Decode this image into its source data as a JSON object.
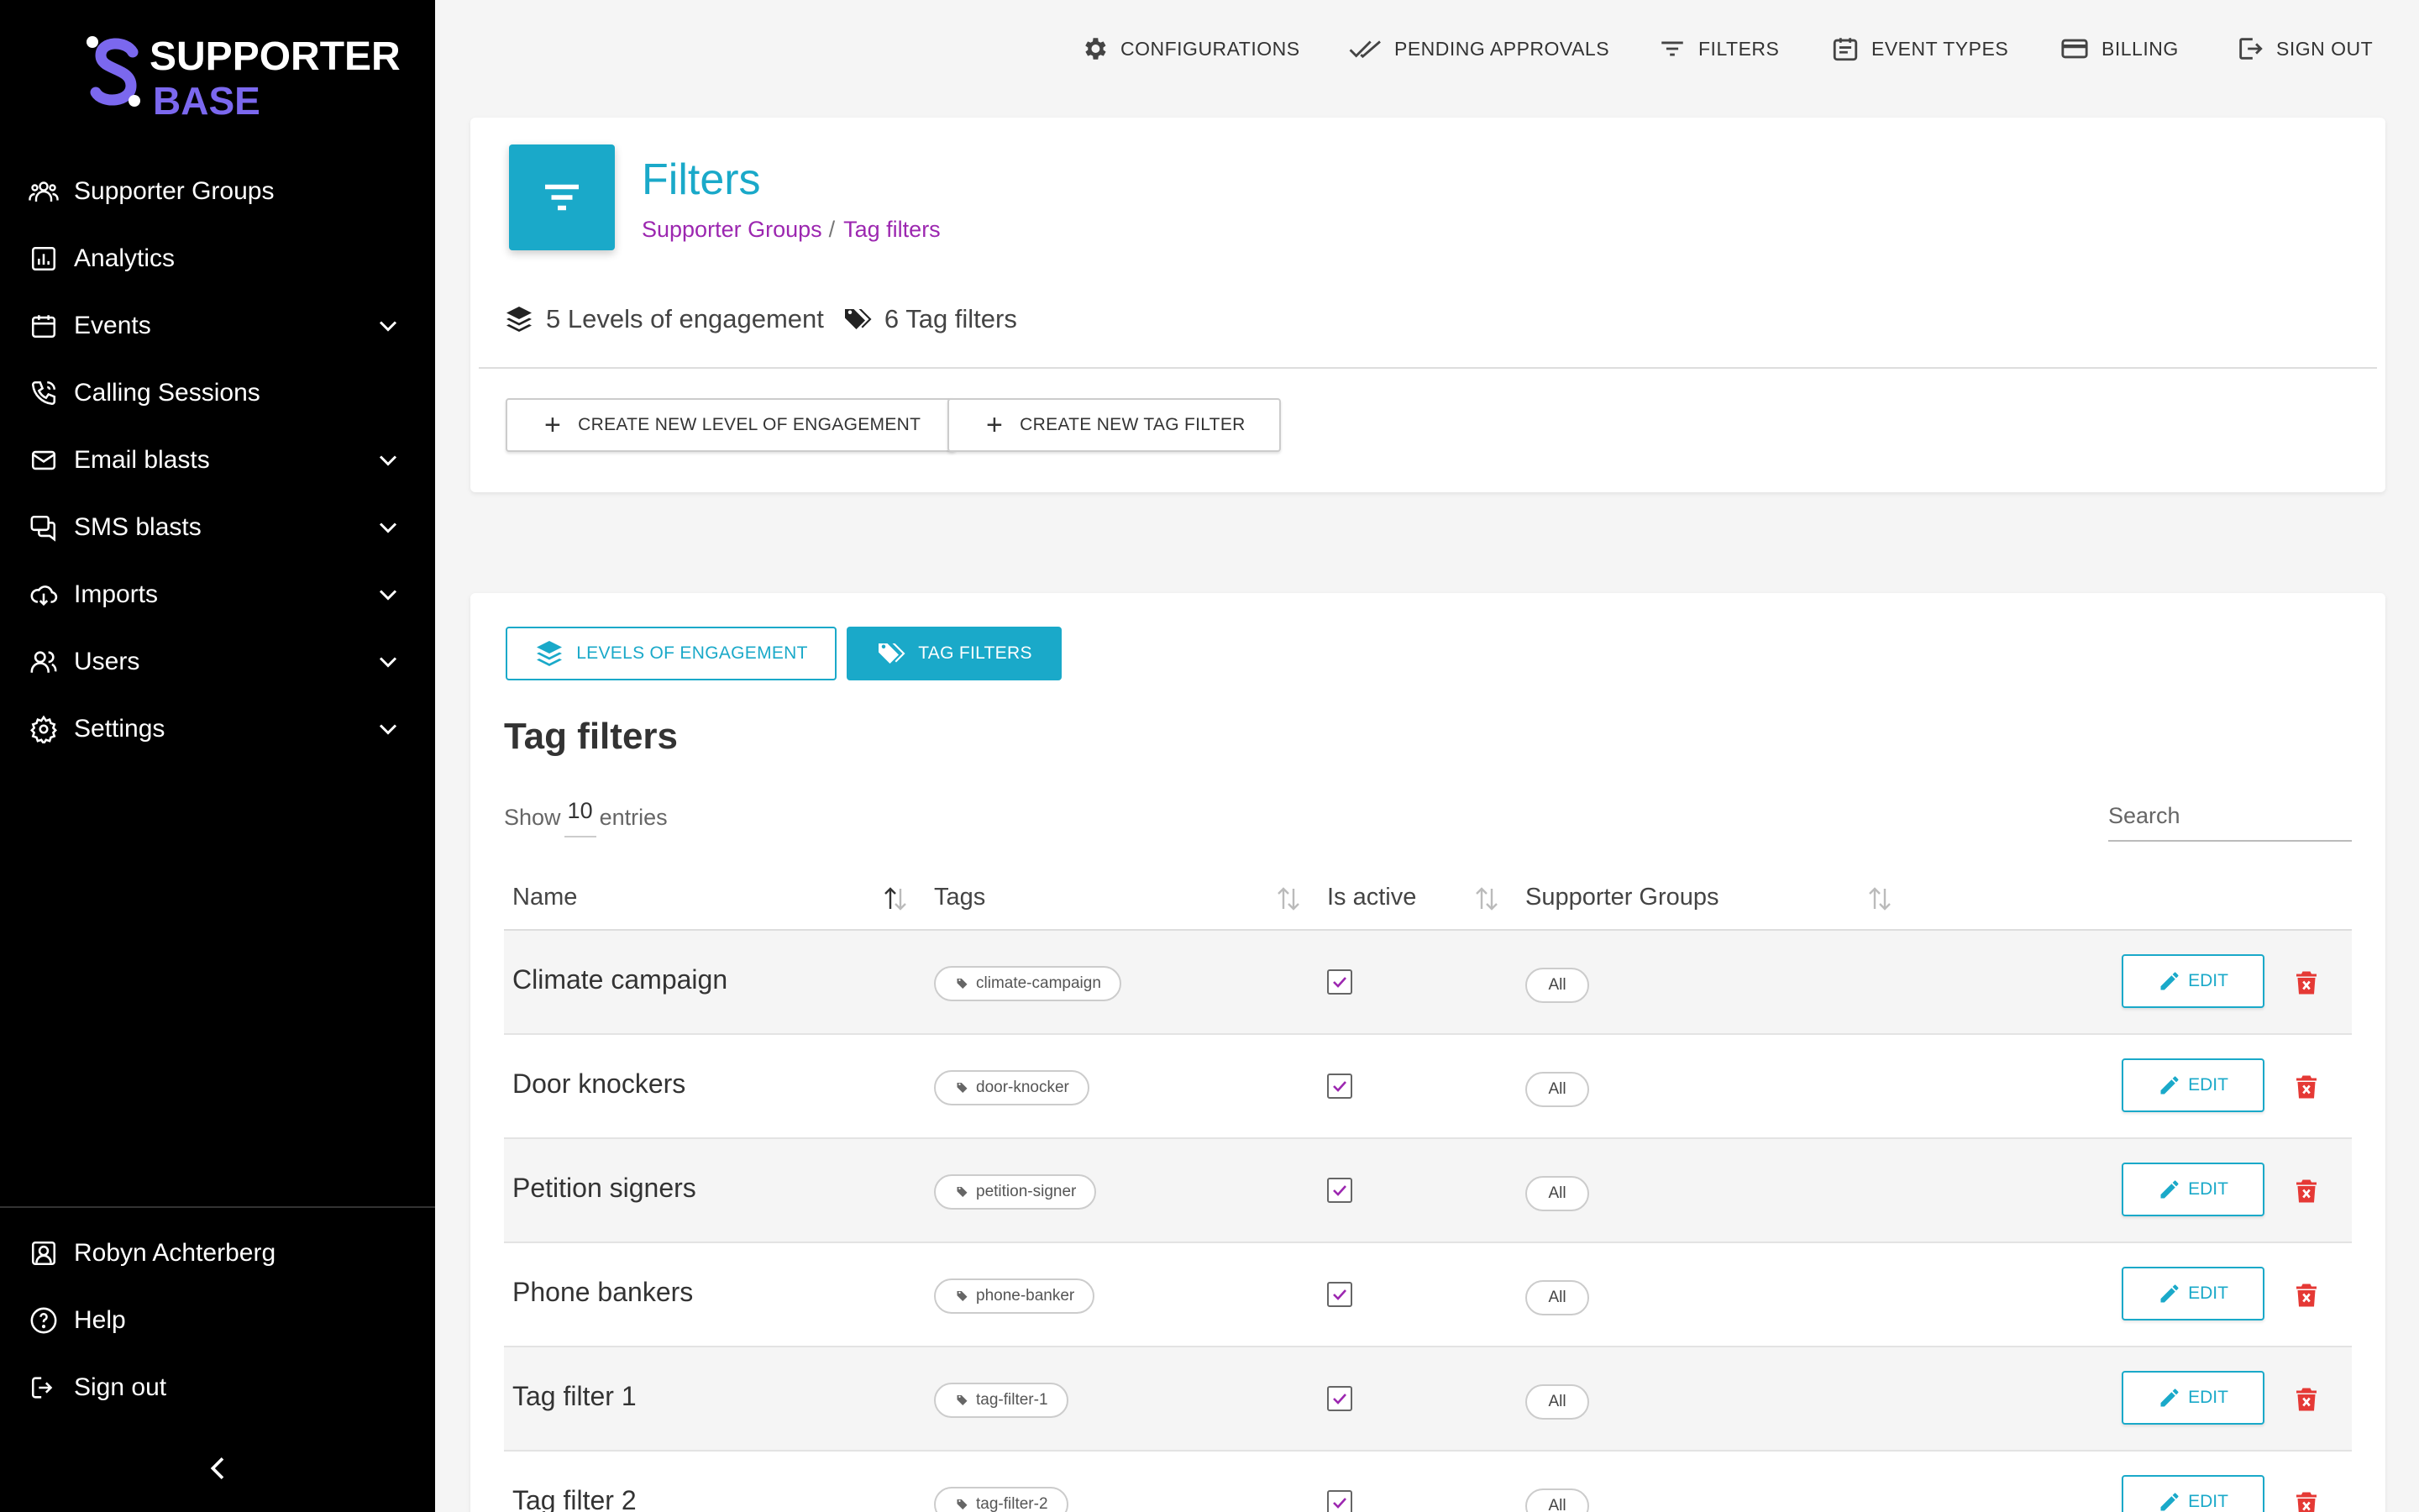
{
  "brand": {
    "line1": "SUPPORTER",
    "line2": "BASE"
  },
  "sidebar": {
    "items": [
      {
        "label": "Supporter Groups",
        "icon": "groups-icon",
        "expandable": false
      },
      {
        "label": "Analytics",
        "icon": "analytics-icon",
        "expandable": false
      },
      {
        "label": "Events",
        "icon": "calendar-icon",
        "expandable": true
      },
      {
        "label": "Calling Sessions",
        "icon": "phone-icon",
        "expandable": false
      },
      {
        "label": "Email blasts",
        "icon": "mail-icon",
        "expandable": true
      },
      {
        "label": "SMS blasts",
        "icon": "chat-icon",
        "expandable": true
      },
      {
        "label": "Imports",
        "icon": "cloud-download-icon",
        "expandable": true
      },
      {
        "label": "Users",
        "icon": "users-icon",
        "expandable": true
      },
      {
        "label": "Settings",
        "icon": "gear-icon",
        "expandable": true
      }
    ],
    "bottom": [
      {
        "label": "Robyn Achterberg",
        "icon": "account-box-icon"
      },
      {
        "label": "Help",
        "icon": "help-icon"
      },
      {
        "label": "Sign out",
        "icon": "logout-icon"
      }
    ]
  },
  "topbar": {
    "configurations": "CONFIGURATIONS",
    "pending": "PENDING APPROVALS",
    "filters": "FILTERS",
    "event_types": "EVENT TYPES",
    "billing": "BILLING",
    "sign_out": "SIGN OUT"
  },
  "header": {
    "title": "Filters",
    "breadcrumb": [
      "Supporter Groups",
      "Tag filters"
    ],
    "breadcrumb_sep": "/",
    "stat_levels": "5 Levels of engagement",
    "stat_tags": "6 Tag filters",
    "btn_new_level": "CREATE NEW LEVEL OF ENGAGEMENT",
    "btn_new_tag": "CREATE NEW TAG FILTER"
  },
  "tabs": {
    "levels": "LEVELS OF ENGAGEMENT",
    "tags": "TAG FILTERS"
  },
  "table": {
    "title": "Tag filters",
    "show_prefix": "Show",
    "show_value": "10",
    "show_suffix": "entries",
    "search_placeholder": "Search",
    "columns": [
      "Name",
      "Tags",
      "Is active",
      "Supporter Groups"
    ],
    "edit_label": "EDIT",
    "rows": [
      {
        "name": "Climate campaign",
        "tag": "climate-campaign",
        "active": true,
        "groups": "All"
      },
      {
        "name": "Door knockers",
        "tag": "door-knocker",
        "active": true,
        "groups": "All"
      },
      {
        "name": "Petition signers",
        "tag": "petition-signer",
        "active": true,
        "groups": "All"
      },
      {
        "name": "Phone bankers",
        "tag": "phone-banker",
        "active": true,
        "groups": "All"
      },
      {
        "name": "Tag filter 1",
        "tag": "tag-filter-1",
        "active": true,
        "groups": "All"
      },
      {
        "name": "Tag filter 2",
        "tag": "tag-filter-2",
        "active": true,
        "groups": "All"
      }
    ]
  },
  "colors": {
    "accent": "#1aa9c9",
    "breadcrumb": "#9c27b0",
    "delete": "#e53935",
    "brand_purple": "#7b68ee"
  }
}
